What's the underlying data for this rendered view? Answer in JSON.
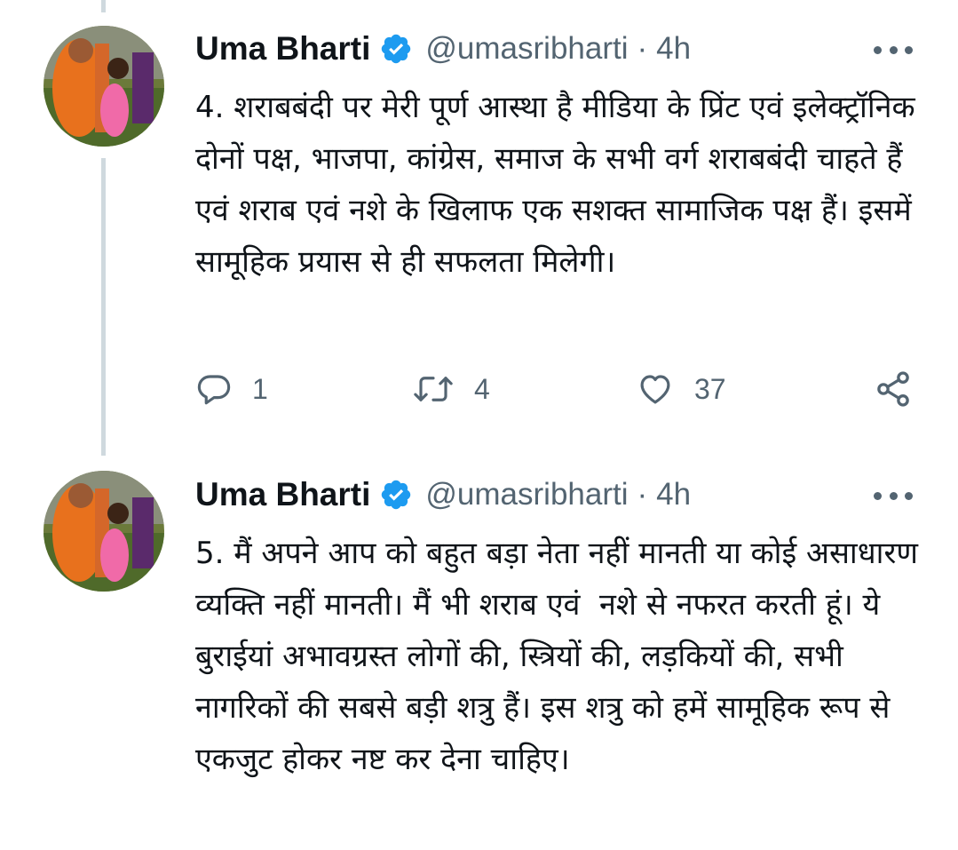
{
  "tweets": [
    {
      "author": {
        "name": "Uma Bharti",
        "handle": "@umasribharti",
        "verified": true
      },
      "separator": "·",
      "time": "4h",
      "text": "4. शराबबंदी पर मेरी पूर्ण आस्था है मीडिया के प्रिंट एवं इलेक्ट्रॉनिक दोनों पक्ष, भाजपा, कांग्रेस, समाज के सभी वर्ग शराबबंदी चाहते हैं एवं शराब एवं नशे के खिलाफ एक सशक्त सामाजिक पक्ष हैं। इसमें  सामूहिक प्रयास से ही सफलता मिलेगी।",
      "stats": {
        "replies": "1",
        "retweets": "4",
        "likes": "37"
      }
    },
    {
      "author": {
        "name": "Uma Bharti",
        "handle": "@umasribharti",
        "verified": true
      },
      "separator": "·",
      "time": "4h",
      "text": "5. मैं अपने आप को बहुत बड़ा नेता नहीं मानती या कोई असाधारण व्यक्ति नहीं मानती। मैं भी शराब एवं  नशे से नफरत करती हूं। ये बुराईयां अभावग्रस्त लोगों की, स्त्रियों की, लड़कियों की, सभी नागरिकों की सबसे बड़ी शत्रु हैं। इस शत्रु को हमें सामूहिक रूप से एकजुट होकर नष्ट कर देना चाहिए।"
    }
  ],
  "icons": {
    "reply": "reply-icon",
    "retweet": "retweet-icon",
    "like": "heart-icon",
    "share": "share-icon",
    "more": "more-icon",
    "verified": "verified-badge-icon"
  },
  "colors": {
    "text": "#0f1419",
    "secondary": "#536471",
    "verified": "#1d9bf0",
    "thread_line": "#cfd9de"
  }
}
